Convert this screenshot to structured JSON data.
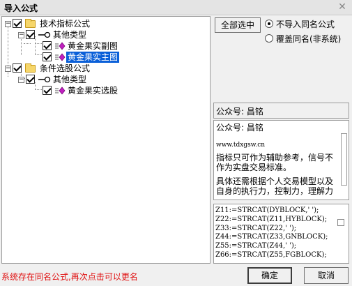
{
  "window": {
    "title": "导入公式",
    "close_glyph": "✕"
  },
  "tree": {
    "nodes": [
      {
        "label": "技术指标公式",
        "expander": "−"
      },
      {
        "label": "其他类型",
        "expander": "−"
      },
      {
        "label": "黄金果实副图"
      },
      {
        "label": "黄金果实主图"
      },
      {
        "label": "条件选股公式",
        "expander": "−"
      },
      {
        "label": "其他类型",
        "expander": "−"
      },
      {
        "label": "黄金果实选股"
      }
    ]
  },
  "buttons": {
    "select_all": "全部选中",
    "ok": "确定",
    "cancel": "取消"
  },
  "options": {
    "skip_same_name": "不导入同名公式",
    "overwrite_same_name": "覆盖同名(非系统)"
  },
  "info": {
    "header": "公众号: 昌铭",
    "desc_title": "公众号: 昌铭",
    "desc_url": "www.tdxgsw.cn",
    "desc_line1": "指标只可作为辅助参考，信号不作为实盘交易标准。",
    "desc_line2": "具体还需根据个人交易模型以及自身的执行力，控制力，理解力"
  },
  "code": {
    "lines": [
      "Z11:=STRCAT(DYBLOCK,' ');",
      "Z22:=STRCAT(Z11,HYBLOCK);",
      "Z33:=STRCAT(Z22,' ');",
      "Z44:=STRCAT(Z33,GNBLOCK);",
      "Z55:=STRCAT(Z44,' ');",
      "Z66:=STRCAT(Z55,FGBLOCK);"
    ]
  },
  "status": {
    "message": "系统存在同名公式,再次点击可以更名"
  },
  "colors": {
    "selection": "#0a5fd8",
    "status_text": "#e01010",
    "folder": "#f6d66a"
  }
}
